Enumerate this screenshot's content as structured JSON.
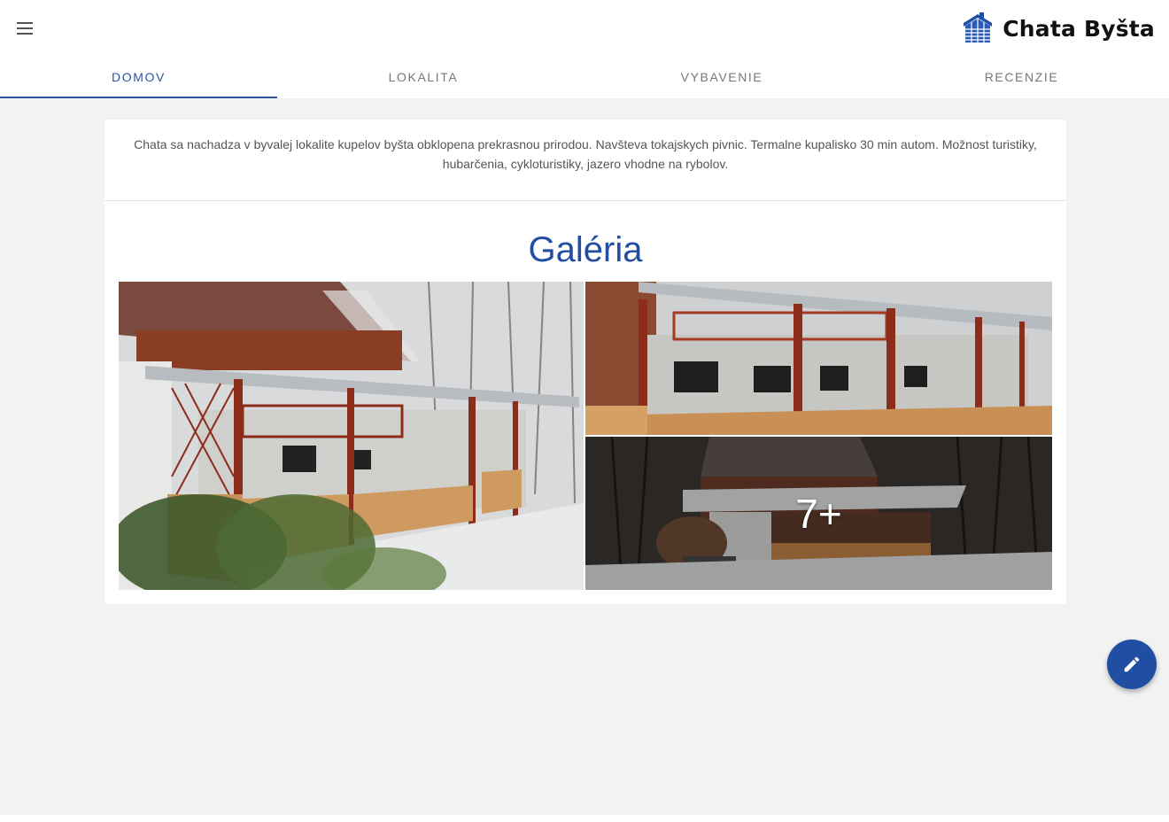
{
  "header": {
    "brand_name": "Chata Byšta",
    "menu_icon": "menu-icon",
    "logo_icon": "house-logo-icon"
  },
  "tabs": [
    {
      "label": "DOMOV",
      "active": true
    },
    {
      "label": "LOKALITA",
      "active": false
    },
    {
      "label": "VYBAVENIE",
      "active": false
    },
    {
      "label": "RECENZIE",
      "active": false
    }
  ],
  "main": {
    "intro_text": "Chata sa nachadza v byvalej lokalite kupelov byšta obklopena prekrasnou prirodou. Navšteva tokajskych pivnic. Termalne kupalisko 30 min autom. Možnost turistiky, hubarčenia, cykloturistiky, jazero vhodne na rybolov.",
    "gallery_title": "Galéria",
    "gallery_more_count": "7+"
  },
  "fab": {
    "icon": "pencil-icon"
  },
  "colors": {
    "accent": "#1f4ea3",
    "tab_active": "#2a55a3",
    "background": "#f2f2f2"
  }
}
